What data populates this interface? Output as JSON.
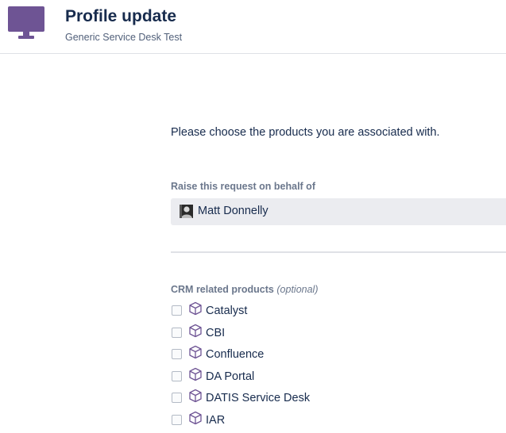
{
  "header": {
    "title": "Profile update",
    "subtitle": "Generic Service Desk Test",
    "icon": "monitor-icon",
    "icon_color": "#6e5494"
  },
  "form": {
    "intro": "Please choose the products you are associated with.",
    "behalf": {
      "label": "Raise this request on behalf of",
      "value": "Matt Donnelly",
      "icon": "avatar"
    },
    "products": {
      "label": "CRM related products",
      "optional": "(optional)",
      "icon": "cube-icon",
      "icon_color": "#6e5494",
      "items": [
        {
          "label": "Catalyst",
          "checked": false
        },
        {
          "label": "CBI",
          "checked": false
        },
        {
          "label": "Confluence",
          "checked": false
        },
        {
          "label": "DA Portal",
          "checked": false
        },
        {
          "label": "DATIS Service Desk",
          "checked": false
        },
        {
          "label": "IAR",
          "checked": false
        }
      ]
    }
  }
}
